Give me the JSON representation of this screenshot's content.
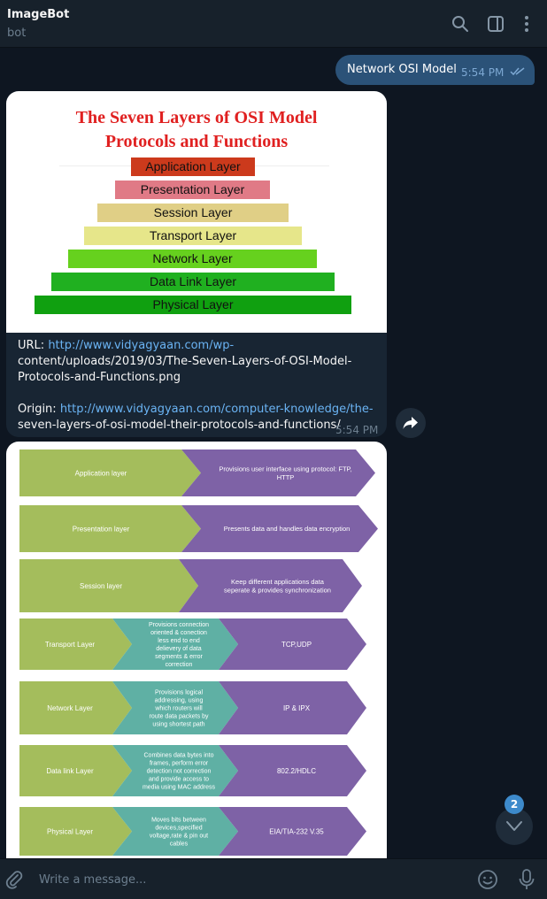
{
  "header": {
    "title": "ImageBot",
    "subtitle": "bot",
    "icons": [
      "search-icon",
      "sidebar-toggle-icon",
      "more-vertical-icon"
    ]
  },
  "outgoing": {
    "text": "Network OSI Model",
    "time": "5:54 PM",
    "status": "read"
  },
  "message1": {
    "image": {
      "title_line1": "The Seven Layers of OSI Model",
      "title_line2": "Protocols and Functions",
      "layers": [
        {
          "label": "Application Layer",
          "color": "#cc3a1c"
        },
        {
          "label": "Presentation Layer",
          "color": "#e07a86"
        },
        {
          "label": "Session Layer",
          "color": "#e0cf86"
        },
        {
          "label": "Transport Layer",
          "color": "#e6e68a"
        },
        {
          "label": "Network Layer",
          "color": "#66d11e"
        },
        {
          "label": "Data Link Layer",
          "color": "#20b020"
        },
        {
          "label": "Physical Layer",
          "color": "#10a010"
        }
      ]
    },
    "url_label": "URL:",
    "url_line1": "http://www.vidyagyaan.com/wp-",
    "url_line2": "content/uploads/2019/03/The-Seven-Layers-of-OSI-Model-",
    "url_line3": "Protocols-and-Functions.png",
    "origin_label": "Origin:",
    "origin_line1": "http://www.vidyagyaan.com/computer-knowledge/the-",
    "origin_line2": "seven-layers-of-osi-model-their-protocols-and-functions/",
    "time": "5:54 PM"
  },
  "message2": {
    "rows": [
      {
        "layer": "Application layer",
        "mid": "",
        "desc_lines": [
          "Provisions user interface using protocol: FTP,",
          "HTTP"
        ]
      },
      {
        "layer": "Presentation layer",
        "mid": "",
        "desc_lines": [
          "Presents data and handles data encryption"
        ]
      },
      {
        "layer": "Session layer",
        "mid": "",
        "desc_lines": [
          "Keep different applications data",
          "seperate & provides synchronization"
        ]
      },
      {
        "layer": "Transport Layer",
        "mid_lines": [
          "Provisions connection",
          "oriented & conection",
          "less end to end",
          "delievery of data",
          "segments & error",
          "correction"
        ],
        "desc_lines": [
          "TCP,UDP"
        ]
      },
      {
        "layer": "Network Layer",
        "mid_lines": [
          "Provisions logical",
          "addressing, using",
          "which routers will",
          "route data packets by",
          "using shortest path"
        ],
        "desc_lines": [
          "IP & IPX"
        ]
      },
      {
        "layer": "Data link Layer",
        "mid_lines": [
          "Combines data bytes into",
          "frames, perform error",
          "detection not correction",
          "and provide access to",
          "media using MAC address"
        ],
        "desc_lines": [
          "802.2/HDLC"
        ]
      },
      {
        "layer": "Physical Layer",
        "mid_lines": [
          "Moves bits between",
          "devices,specified",
          "voltage,rate & pin out",
          "cables"
        ],
        "desc_lines": [
          "EIA/TIA-232 V.35"
        ]
      }
    ],
    "colors": {
      "green": "#a4bd5c",
      "teal": "#5fb0a4",
      "purple": "#7e62a6"
    }
  },
  "scroll": {
    "unread_count": "2"
  },
  "composer": {
    "placeholder": "Write a message..."
  }
}
